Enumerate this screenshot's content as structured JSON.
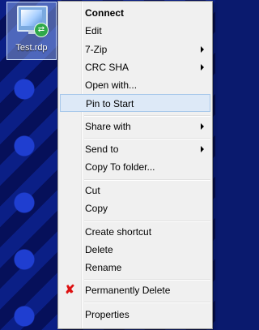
{
  "desktop": {
    "file": {
      "label": "Test.rdp"
    }
  },
  "menu": {
    "items": [
      {
        "label": "Connect"
      },
      {
        "label": "Edit"
      },
      {
        "label": "7-Zip"
      },
      {
        "label": "CRC SHA"
      },
      {
        "label": "Open with..."
      },
      {
        "label": "Pin to Start"
      },
      {
        "label": "Share with"
      },
      {
        "label": "Send to"
      },
      {
        "label": "Copy To folder..."
      },
      {
        "label": "Cut"
      },
      {
        "label": "Copy"
      },
      {
        "label": "Create shortcut"
      },
      {
        "label": "Delete"
      },
      {
        "label": "Rename"
      },
      {
        "label": "Permanently Delete",
        "icon": "red-x-icon"
      },
      {
        "label": "Properties"
      }
    ]
  },
  "colors": {
    "menu_background": "#f0f0f0",
    "highlight": "#dde9f7",
    "delete_icon": "#dd1111"
  }
}
